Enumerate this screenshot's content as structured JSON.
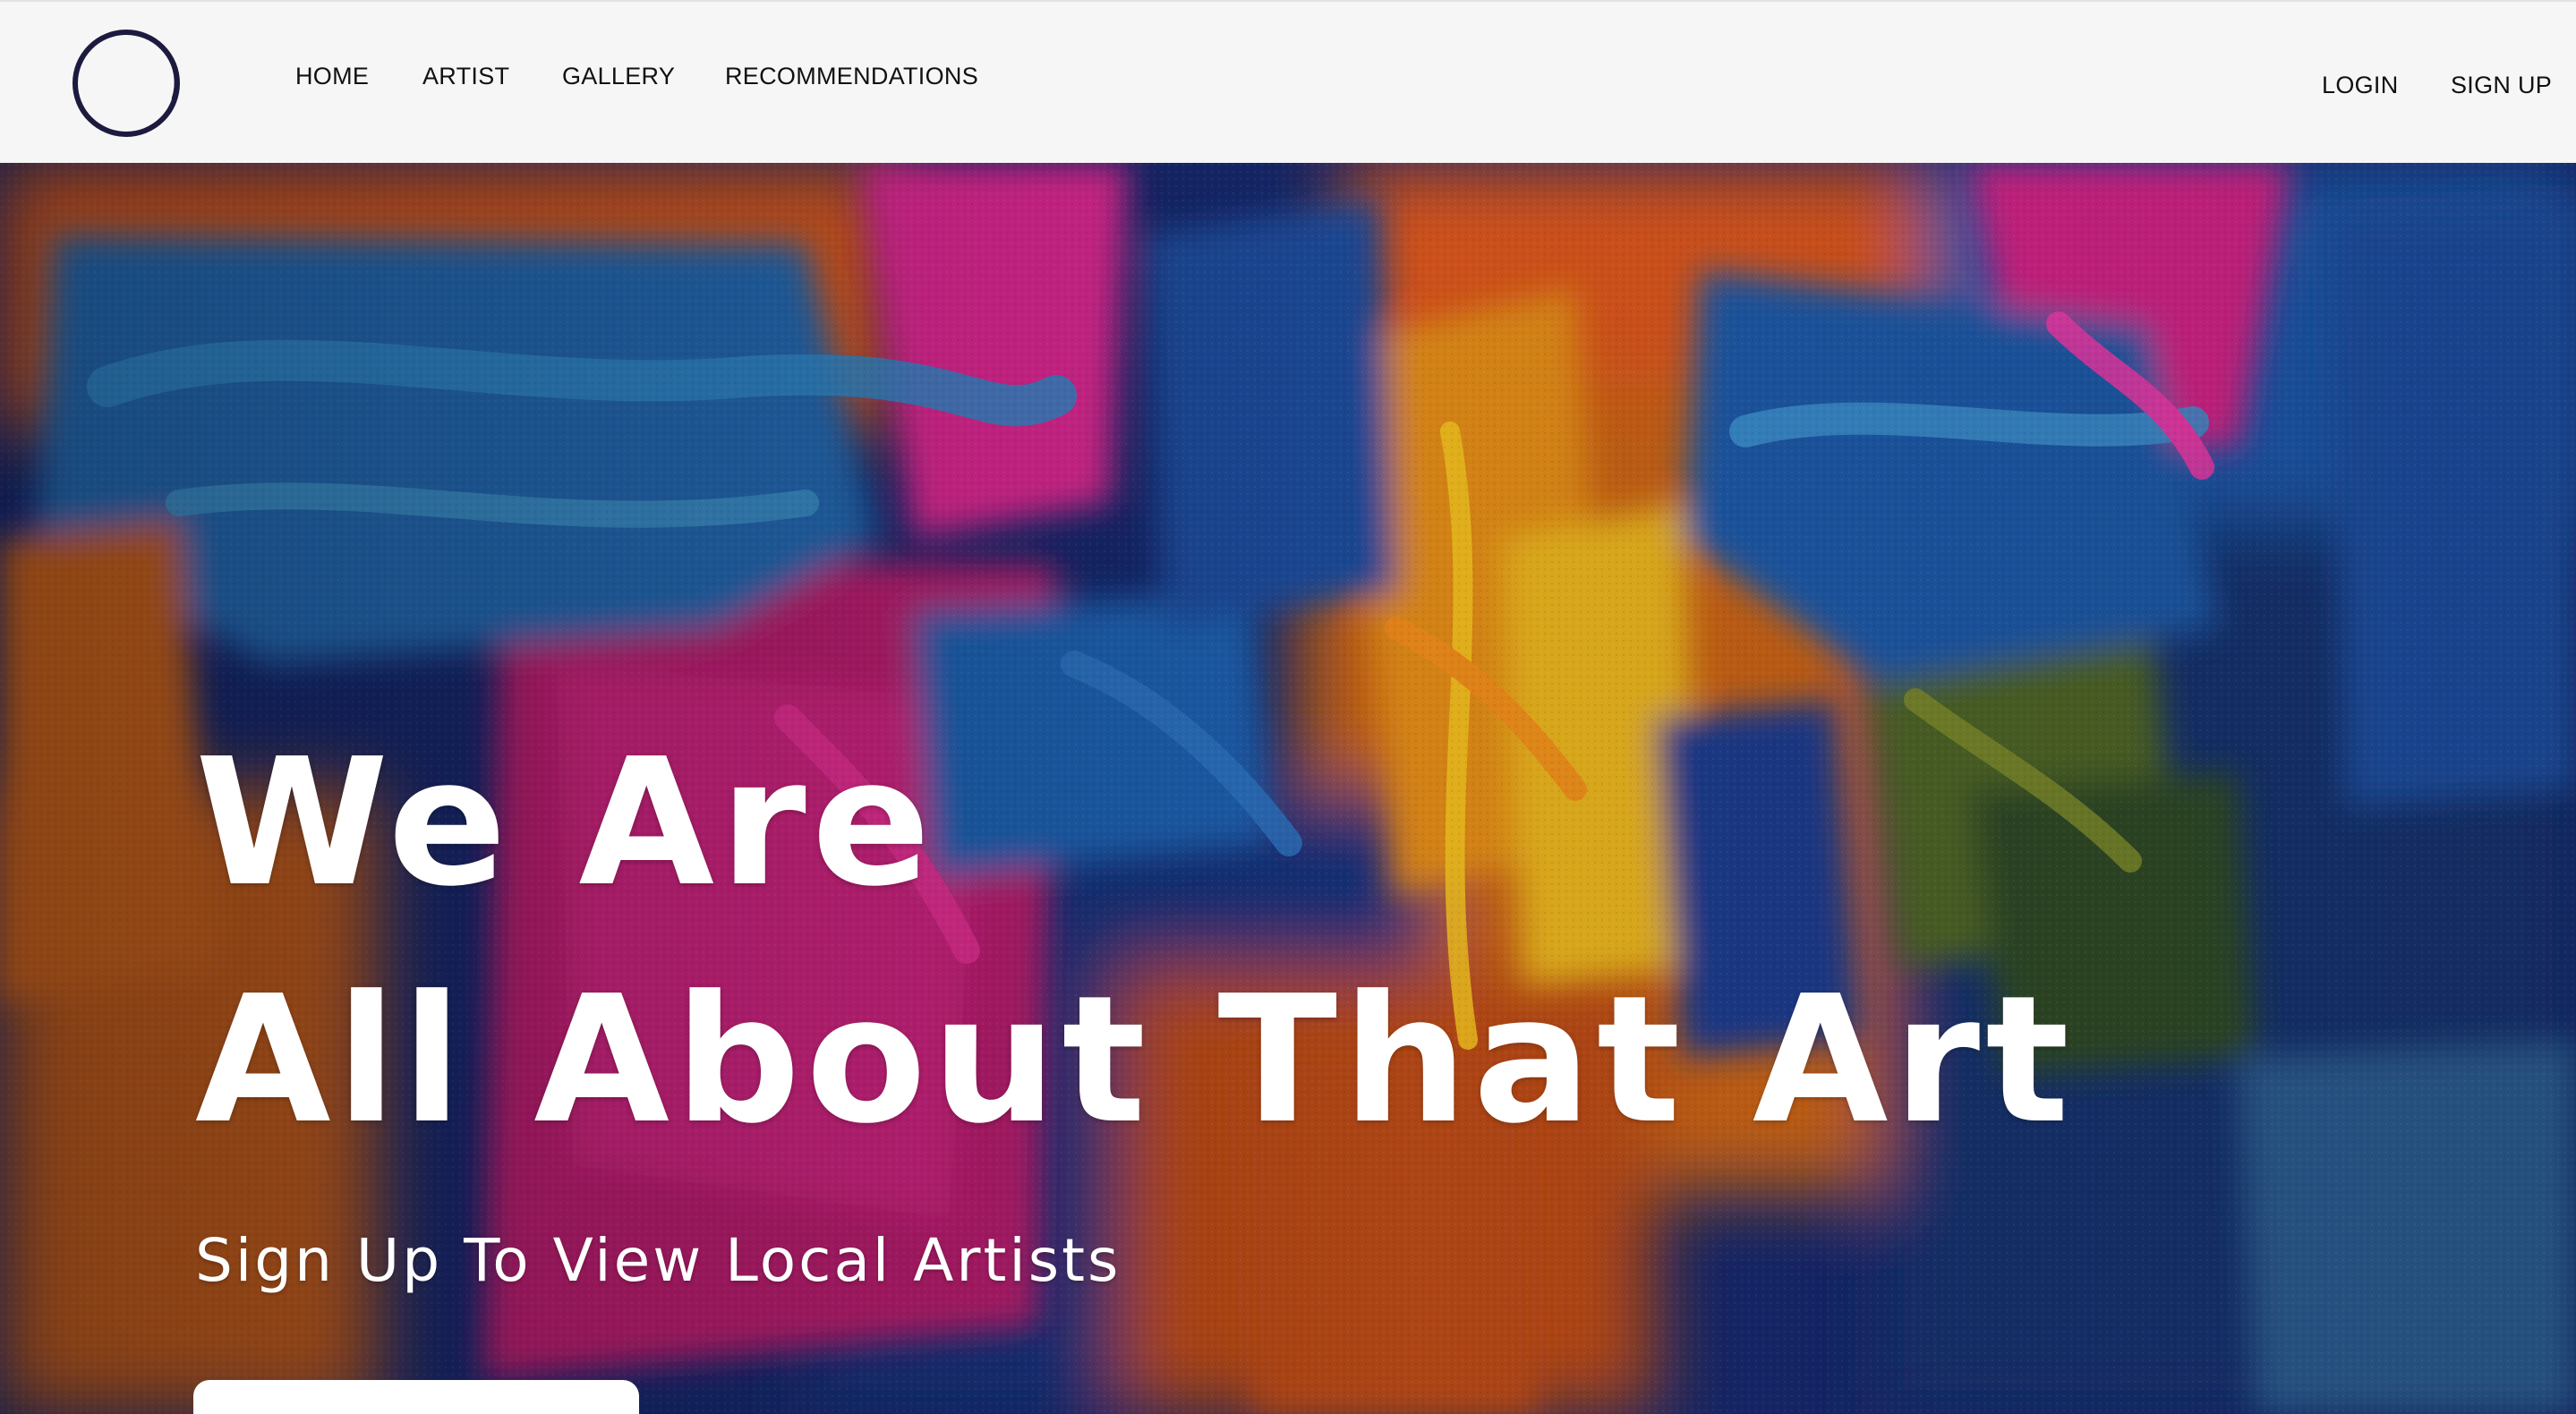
{
  "nav": {
    "links": [
      "HOME",
      "ARTIST",
      "GALLERY",
      "RECOMMENDATIONS"
    ],
    "login_label": "LOGIN",
    "signup_label": "SIGN UP"
  },
  "logo": {
    "icon": "circle-ring-logo-icon",
    "color": "#1c1b3f"
  },
  "hero": {
    "title_line1": "We Are",
    "title_line2": "All About That Art",
    "subtitle": "Sign Up To View Local Artists",
    "cta_label": ""
  },
  "colors": {
    "navbar_bg": "#f6f6f6",
    "text_dark": "#111111",
    "hero_text": "#ffffff",
    "paint_blue": "#1e5aa8",
    "paint_navy": "#13205e",
    "paint_magenta": "#d51f8f",
    "paint_orange": "#e0571a",
    "paint_yellow": "#e7b21a",
    "paint_green": "#4e6a2a"
  }
}
